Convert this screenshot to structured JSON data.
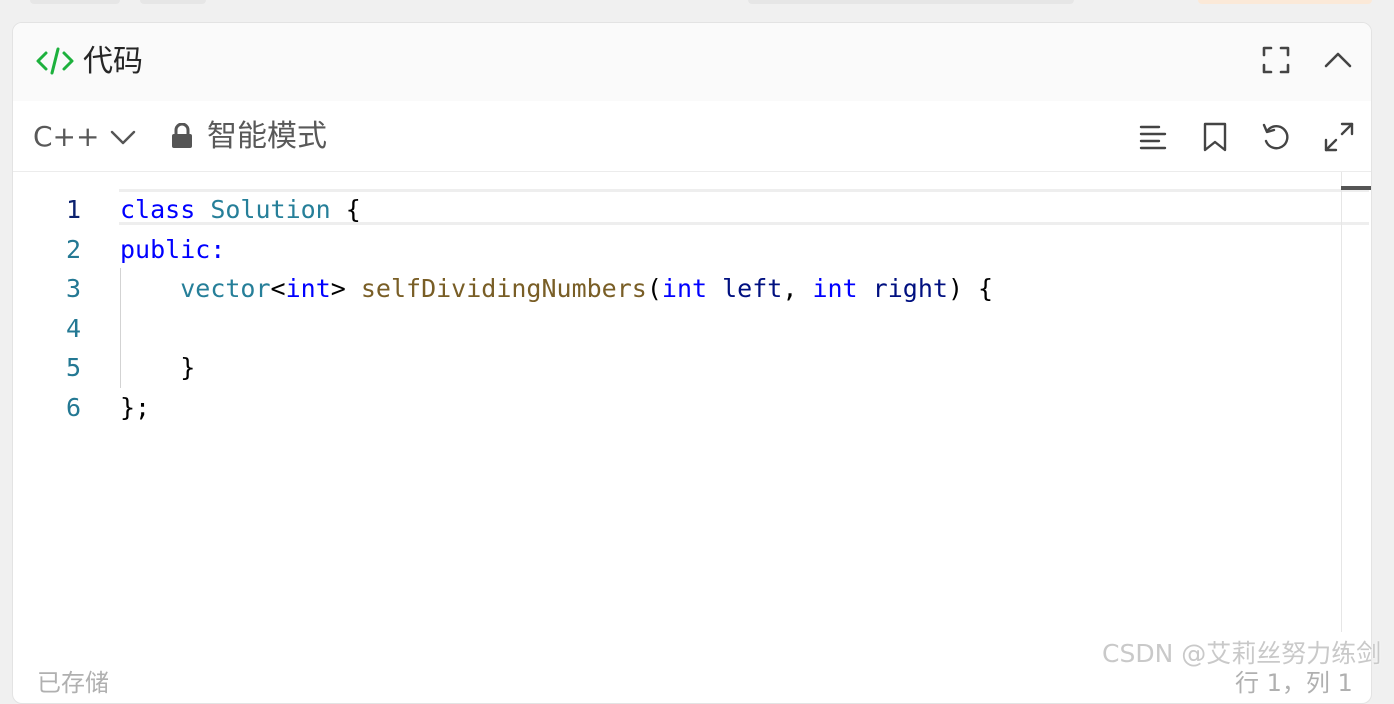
{
  "panel": {
    "title": "代码",
    "icons": {
      "code": "code-brackets-icon",
      "fullscreen": "fullscreen-icon",
      "collapse": "chevron-up-icon"
    },
    "accent_color": "#1db13d"
  },
  "toolbar": {
    "language": "C++",
    "mode_label": "智能模式",
    "icons": [
      "format-align-icon",
      "bookmark-icon",
      "undo-icon",
      "expand-icon"
    ]
  },
  "editor": {
    "line_numbers": [
      "1",
      "2",
      "3",
      "4",
      "5",
      "6"
    ],
    "lines": [
      [
        {
          "t": "class",
          "c": "kw"
        },
        {
          "t": " "
        },
        {
          "t": "Solution",
          "c": "ty"
        },
        {
          "t": " {"
        }
      ],
      [
        {
          "t": "public:",
          "c": "kw"
        }
      ],
      [
        {
          "t": "    "
        },
        {
          "t": "vector",
          "c": "ty"
        },
        {
          "t": "<"
        },
        {
          "t": "int",
          "c": "kw"
        },
        {
          "t": "> "
        },
        {
          "t": "selfDividingNumbers",
          "c": "fn"
        },
        {
          "t": "("
        },
        {
          "t": "int",
          "c": "kw"
        },
        {
          "t": " "
        },
        {
          "t": "left",
          "c": "pa"
        },
        {
          "t": ", "
        },
        {
          "t": "int",
          "c": "kw"
        },
        {
          "t": " "
        },
        {
          "t": "right",
          "c": "pa"
        },
        {
          "t": ") {"
        }
      ],
      [
        {
          "t": ""
        }
      ],
      [
        {
          "t": "    }"
        }
      ],
      [
        {
          "t": "};"
        }
      ]
    ],
    "active_line": 1,
    "colors": {
      "keyword": "#0000ff",
      "type": "#267f99",
      "function": "#795e26",
      "param": "#001080",
      "line_number": "#237893"
    }
  },
  "footer": {
    "left_text": "已存储",
    "right_text": "行 1，列 1"
  },
  "watermark": "CSDN @艾莉丝努力练剑"
}
